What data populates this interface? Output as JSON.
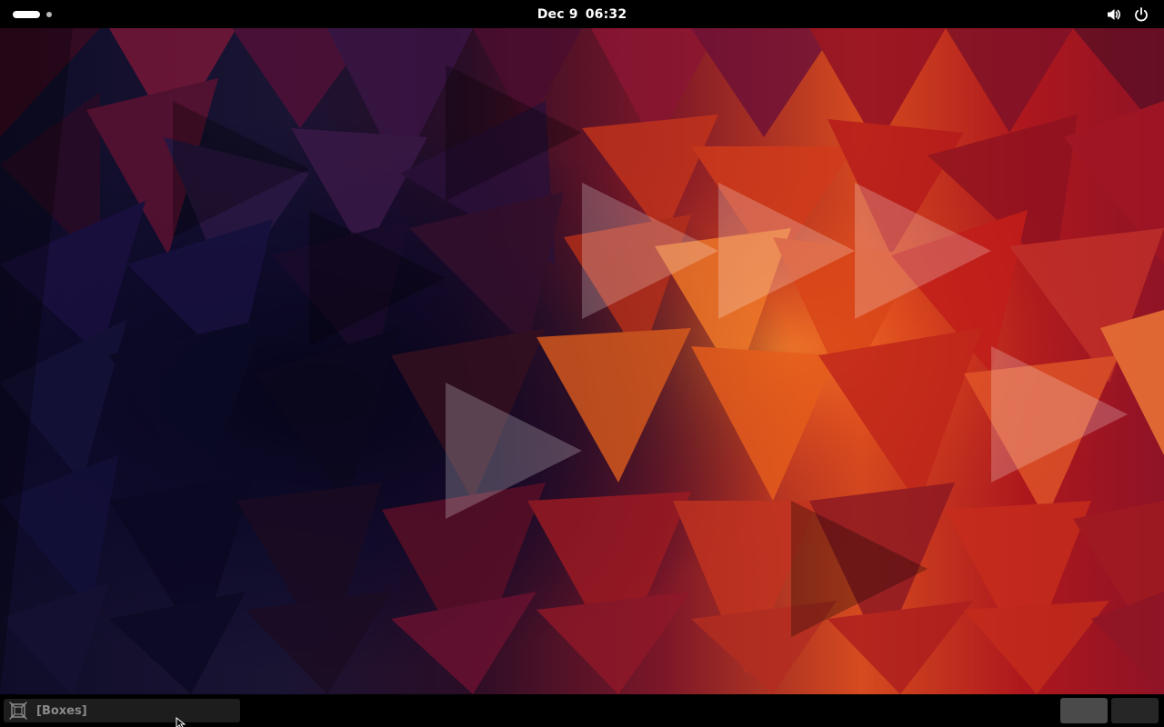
{
  "top_bar": {
    "date": "Dec 9",
    "time": "06:32",
    "icons": {
      "activities": "workspace-indicator",
      "volume": "volume-icon",
      "power": "power-icon"
    }
  },
  "desktop": {
    "wallpaper": "red-orange-purple-triangle-pattern",
    "colors": {
      "accent_orange": "#f06a1f",
      "accent_red": "#c6231b",
      "deep_purple": "#1c1238",
      "wine": "#6d1237"
    }
  },
  "bottom_bar": {
    "window_title": "[Boxes]",
    "window_icon": "boxes-icon",
    "workspaces": [
      {
        "label": "",
        "active": true
      },
      {
        "label": "",
        "active": false
      }
    ]
  }
}
